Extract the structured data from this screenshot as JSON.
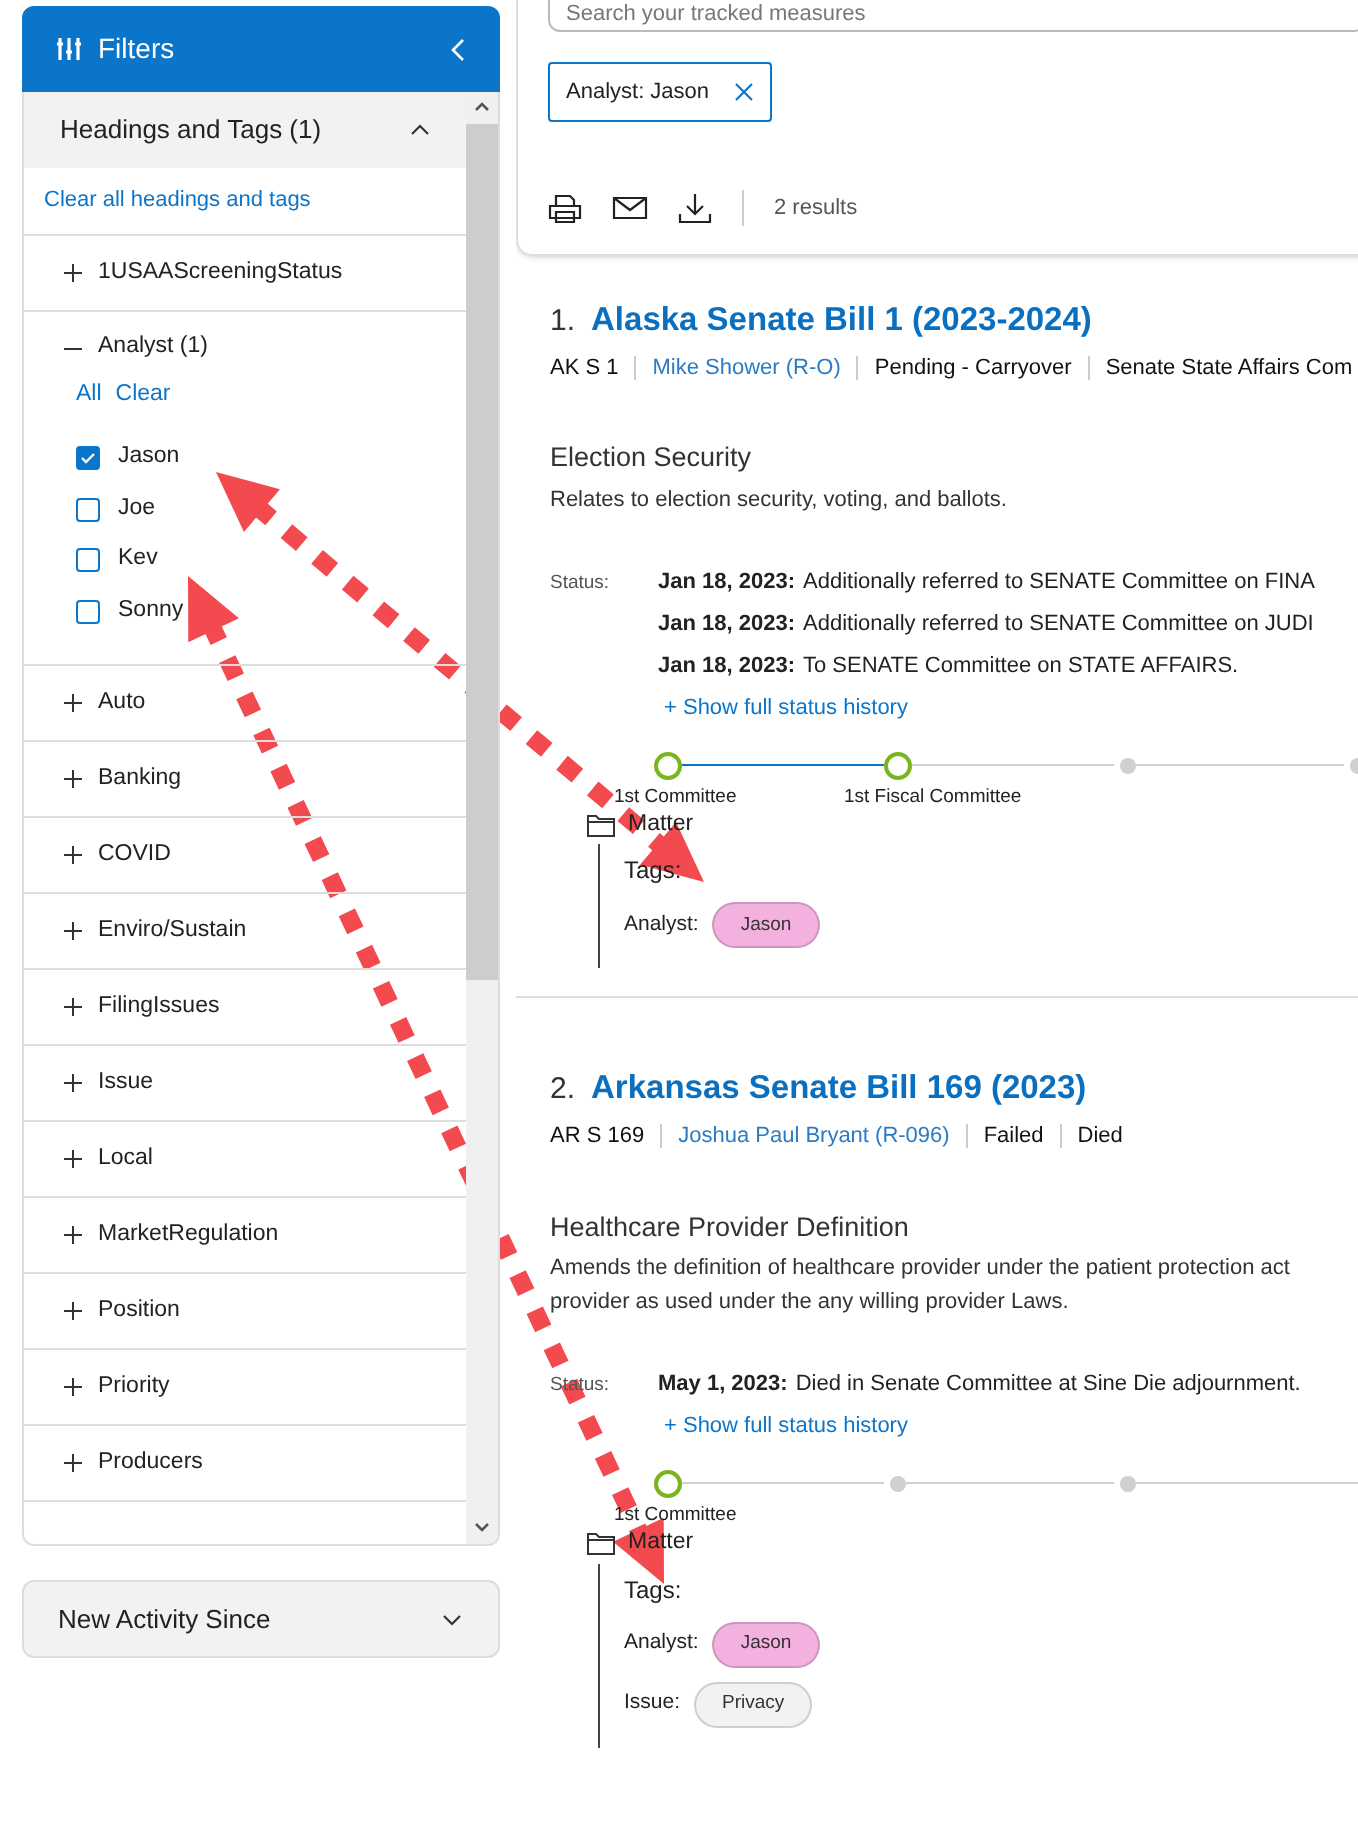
{
  "sidebar": {
    "title": "Filters",
    "section": {
      "title": "Headings and Tags (1)",
      "expanded": true,
      "clear_link": "Clear all headings and tags",
      "groups": [
        {
          "label": "1USAAScreeningStatus",
          "expanded": false
        },
        {
          "label": "Analyst (1)",
          "expanded": true,
          "links": [
            "All",
            "Clear"
          ],
          "options": [
            {
              "label": "Jason",
              "checked": true
            },
            {
              "label": "Joe",
              "checked": false
            },
            {
              "label": "Kev",
              "checked": false
            },
            {
              "label": "Sonny",
              "checked": false
            }
          ]
        },
        {
          "label": "Auto",
          "expanded": false
        },
        {
          "label": "Banking",
          "expanded": false
        },
        {
          "label": "COVID",
          "expanded": false
        },
        {
          "label": "Enviro/Sustain",
          "expanded": false
        },
        {
          "label": "FilingIssues",
          "expanded": false
        },
        {
          "label": "Issue",
          "expanded": false
        },
        {
          "label": "Local",
          "expanded": false
        },
        {
          "label": "MarketRegulation",
          "expanded": false
        },
        {
          "label": "Position",
          "expanded": false
        },
        {
          "label": "Priority",
          "expanded": false
        },
        {
          "label": "Producers",
          "expanded": false
        }
      ]
    },
    "new_activity": {
      "label": "New Activity Since",
      "expanded": false
    }
  },
  "search": {
    "placeholder": "Search your tracked measures"
  },
  "chips": [
    {
      "label": "Analyst: Jason"
    }
  ],
  "results_count": "2 results",
  "results": [
    {
      "number": "1.",
      "title": "Alaska Senate Bill 1 (2023-2024)",
      "meta": [
        {
          "text": "AK S 1",
          "kind": "text"
        },
        {
          "text": "Mike Shower (R-O)",
          "kind": "link"
        },
        {
          "text": "Pending - Carryover",
          "kind": "text"
        },
        {
          "text": "Senate State Affairs Com",
          "kind": "text"
        }
      ],
      "topic": "Election Security",
      "summary": "Relates to election security, voting, and ballots.",
      "status_label": "Status:",
      "status": [
        {
          "date": "Jan 18, 2023:",
          "text": "Additionally referred to SENATE Committee on FINA"
        },
        {
          "date": "Jan 18, 2023:",
          "text": "Additionally referred to SENATE Committee on JUDI"
        },
        {
          "date": "Jan 18, 2023:",
          "text": "To SENATE Committee on STATE AFFAIRS."
        }
      ],
      "history_link": "+ Show full status history",
      "timeline": [
        {
          "label": "1st Committee",
          "reached": true
        },
        {
          "label": "1st Fiscal Committee",
          "reached": true
        },
        {
          "reached": false
        },
        {
          "reached": false
        }
      ],
      "folder": "Matter",
      "tags_label": "Tags:",
      "tags": [
        {
          "name": "Analyst:",
          "values": [
            {
              "label": "Jason",
              "color": "#f2b1de"
            }
          ]
        }
      ]
    },
    {
      "number": "2.",
      "title": "Arkansas Senate Bill 169 (2023)",
      "meta": [
        {
          "text": "AR S 169",
          "kind": "text"
        },
        {
          "text": "Joshua Paul Bryant (R-096)",
          "kind": "link"
        },
        {
          "text": "Failed",
          "kind": "text"
        },
        {
          "text": "Died",
          "kind": "text"
        }
      ],
      "topic": "Healthcare Provider Definition",
      "summary": "Amends the definition of healthcare provider under the patient protection act provider as used under the any willing provider Laws.",
      "status_label": "Status:",
      "status": [
        {
          "date": "May 1, 2023:",
          "text": "Died in Senate Committee at Sine Die adjournment."
        }
      ],
      "history_link": "+ Show full status history",
      "timeline": [
        {
          "label": "1st Committee",
          "reached": true
        },
        {
          "reached": false
        },
        {
          "reached": false
        }
      ],
      "folder": "Matter",
      "tags_label": "Tags:",
      "tags": [
        {
          "name": "Analyst:",
          "values": [
            {
              "label": "Jason",
              "color": "#f2b1de"
            }
          ]
        },
        {
          "name": "Issue:",
          "values": [
            {
              "label": "Privacy",
              "color": "#f2f2f2"
            }
          ]
        }
      ]
    }
  ]
}
